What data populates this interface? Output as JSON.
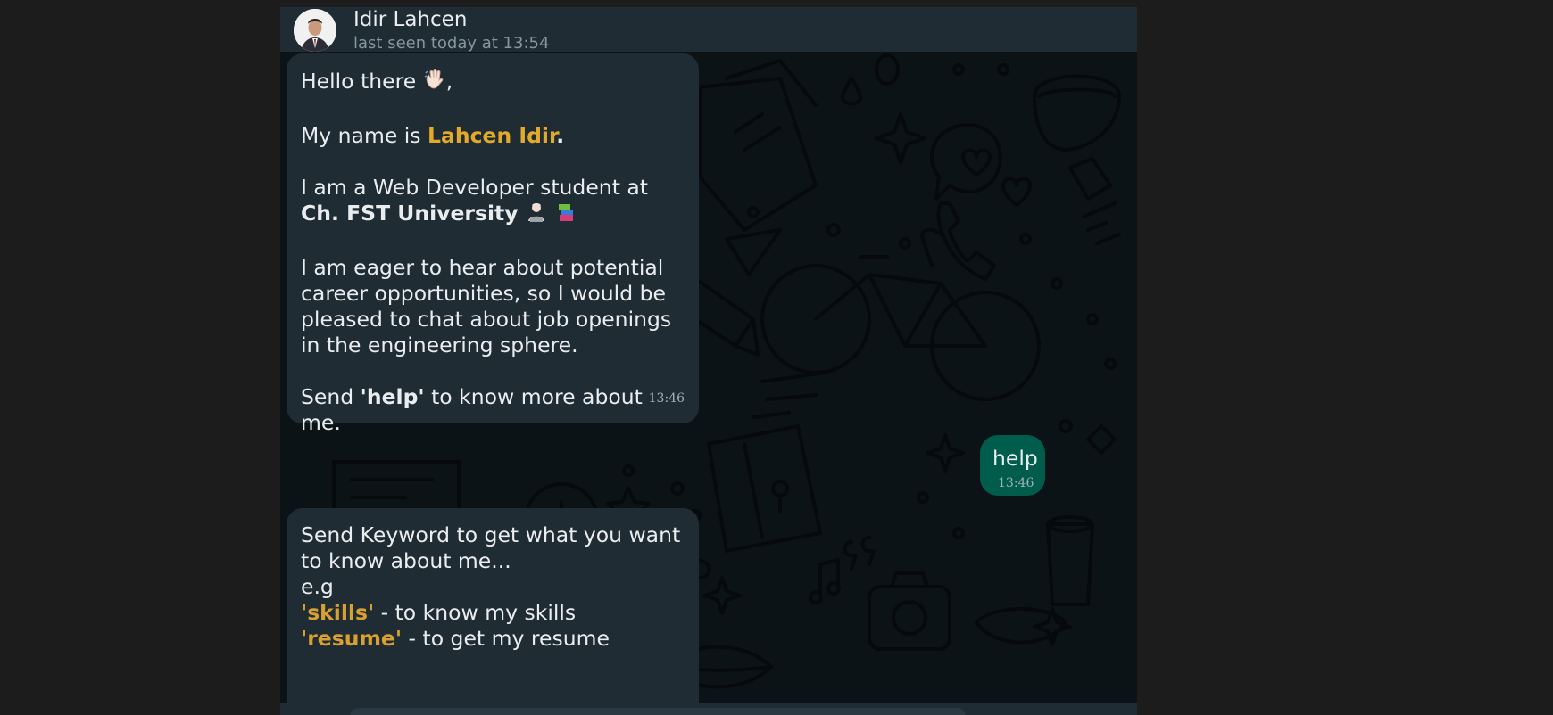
{
  "header": {
    "contact_name": "Idir Lahcen",
    "last_seen": "last seen today at 13:54"
  },
  "messages": {
    "intro": {
      "greeting": "Hello there",
      "name_prefix": "My name is ",
      "name": "Lahcen Idir",
      "name_suffix": ".",
      "study_line1": "I am a Web Developer student at",
      "university": "Ch. FST University",
      "eager": "I am eager to hear about potential career opportunities, so I would be pleased to chat about job openings in the engineering sphere.",
      "send_prefix": "Send ",
      "send_keyword": "'help'",
      "send_suffix": " to know more about me.",
      "time": "13:46"
    },
    "help": {
      "text": "help",
      "time": "13:46"
    },
    "keywords": {
      "line1": "Send Keyword to get what you want to know about me...",
      "eg": "e.g",
      "items": [
        {
          "keyword": "'skills'",
          "desc": " - to know my skills"
        },
        {
          "keyword": "'resume'",
          "desc": " - to get my resume"
        }
      ]
    }
  },
  "colors": {
    "accent": "#e2a92b",
    "incoming_bubble": "#202c33",
    "outgoing_bubble": "#005c4b",
    "header_bg": "#1f2c33"
  },
  "icons": {
    "wave": "waving-hand-icon",
    "technologist": "technologist-icon",
    "books": "books-icon"
  }
}
